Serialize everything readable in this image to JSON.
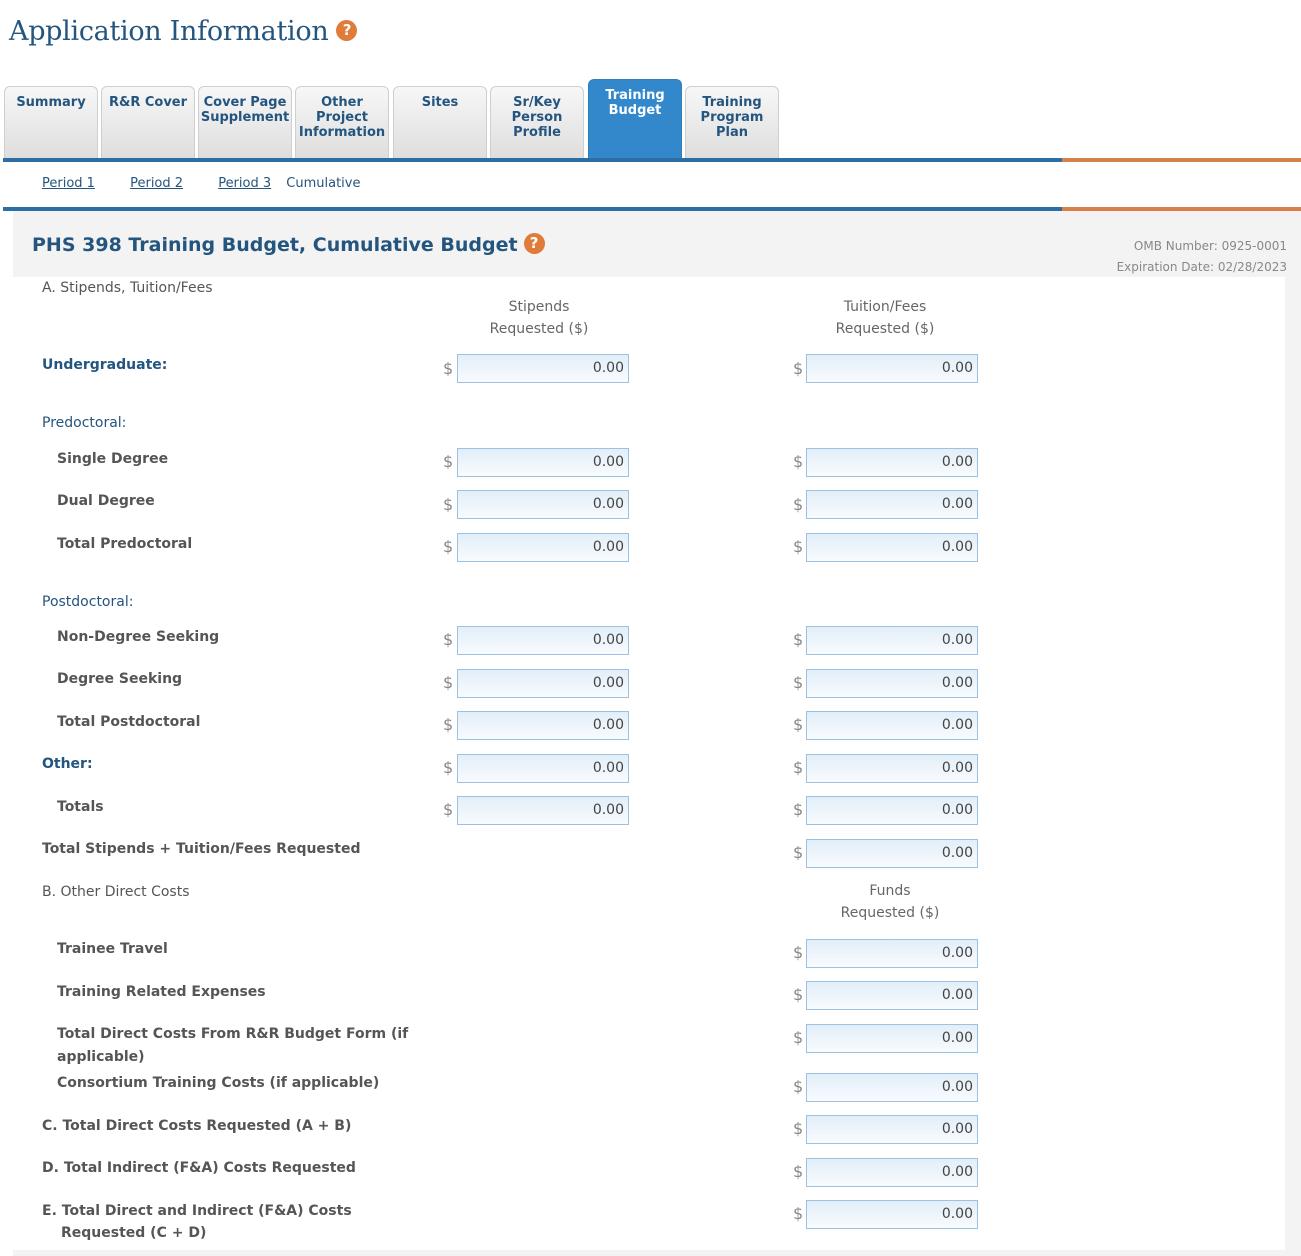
{
  "page": {
    "title": "Application Information"
  },
  "tabs": [
    {
      "label": "Summary"
    },
    {
      "label": "R&R Cover"
    },
    {
      "label": "Cover Page Supplement"
    },
    {
      "label": "Other Project Information"
    },
    {
      "label": "Sites"
    },
    {
      "label": "Sr/Key Person Profile"
    },
    {
      "label": "Training Budget",
      "active": true
    },
    {
      "label": "Training Program Plan"
    }
  ],
  "subnav": {
    "period1": "Period 1",
    "period2": "Period 2",
    "period3": "Period 3",
    "current": "Cumulative"
  },
  "form": {
    "title": "PHS 398 Training Budget, Cumulative Budget",
    "omb_number": "OMB Number: 0925-0001",
    "expiration": "Expiration Date: 02/28/2023"
  },
  "section_a": {
    "heading": "A. Stipends, Tuition/Fees",
    "col_stipends": [
      "Stipends",
      "Requested ($)"
    ],
    "col_tuition": [
      "Tuition/Fees",
      "Requested ($)"
    ],
    "currency": "$",
    "undergraduate": {
      "label": "Undergraduate:",
      "stipend": "0.00",
      "tuition": "0.00"
    },
    "predoctoral_heading": "Predoctoral:",
    "single_degree": {
      "label": "Single Degree",
      "stipend": "0.00",
      "tuition": "0.00"
    },
    "dual_degree": {
      "label": "Dual Degree",
      "stipend": "0.00",
      "tuition": "0.00"
    },
    "total_predoctoral": {
      "label": "Total Predoctoral",
      "stipend": "0.00",
      "tuition": "0.00"
    },
    "postdoctoral_heading": "Postdoctoral:",
    "non_degree": {
      "label": "Non-Degree Seeking",
      "stipend": "0.00",
      "tuition": "0.00"
    },
    "degree_seeking": {
      "label": "Degree Seeking",
      "stipend": "0.00",
      "tuition": "0.00"
    },
    "total_postdoctoral": {
      "label": "Total Postdoctoral",
      "stipend": "0.00",
      "tuition": "0.00"
    },
    "other": {
      "label": "Other:",
      "stipend": "0.00",
      "tuition": "0.00"
    },
    "totals": {
      "label": "Totals",
      "stipend": "0.00",
      "tuition": "0.00"
    },
    "total_requested": {
      "label": "Total Stipends + Tuition/Fees Requested",
      "value": "0.00"
    }
  },
  "section_b": {
    "heading": "B. Other Direct Costs",
    "col_funds": [
      "Funds",
      "Requested ($)"
    ],
    "trainee_travel": {
      "label": "Trainee Travel",
      "value": "0.00"
    },
    "training_related": {
      "label": "Training Related Expenses",
      "value": "0.00"
    },
    "total_direct_rr": {
      "label_line1": "Total Direct Costs From R&R Budget Form (if",
      "label_line2": "applicable)",
      "value": "0.00"
    },
    "consortium": {
      "label": "Consortium Training Costs (if applicable)",
      "value": "0.00"
    }
  },
  "section_c": {
    "label": "C. Total Direct Costs Requested (A + B)",
    "value": "0.00"
  },
  "section_d": {
    "label": "D. Total Indirect (F&A) Costs Requested",
    "value": "0.00"
  },
  "section_e": {
    "label_line1": "E. Total Direct and Indirect (F&A) Costs",
    "label_line2": "Requested (C + D)",
    "value": "0.00"
  }
}
